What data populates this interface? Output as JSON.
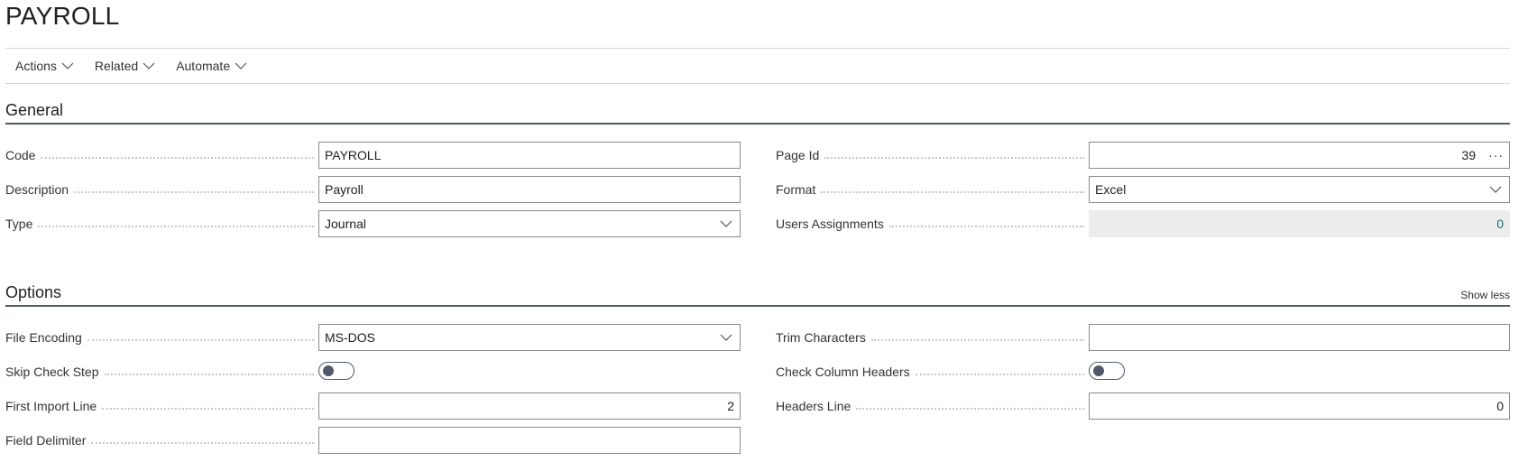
{
  "page": {
    "title": "PAYROLL"
  },
  "actions": [
    {
      "label": "Actions"
    },
    {
      "label": "Related"
    },
    {
      "label": "Automate"
    }
  ],
  "general": {
    "title": "General",
    "code": {
      "label": "Code",
      "value": "PAYROLL"
    },
    "description": {
      "label": "Description",
      "value": "Payroll"
    },
    "type": {
      "label": "Type",
      "value": "Journal"
    },
    "page_id": {
      "label": "Page Id",
      "value": "39"
    },
    "format": {
      "label": "Format",
      "value": "Excel"
    },
    "users_assignments": {
      "label": "Users Assignments",
      "value": "0"
    }
  },
  "options": {
    "title": "Options",
    "show_less": "Show less",
    "file_encoding": {
      "label": "File Encoding",
      "value": "MS-DOS"
    },
    "skip_check_step": {
      "label": "Skip Check Step",
      "value": false
    },
    "first_import_line": {
      "label": "First Import Line",
      "value": "2"
    },
    "field_delimiter": {
      "label": "Field Delimiter",
      "value": ""
    },
    "trim_characters": {
      "label": "Trim Characters",
      "value": ""
    },
    "check_column_headers": {
      "label": "Check Column Headers",
      "value": false
    },
    "headers_line": {
      "label": "Headers Line",
      "value": "0"
    }
  },
  "colors": {
    "accent": "#505a6a",
    "link": "#1d6a7e",
    "readonly_bg": "#ececec"
  }
}
